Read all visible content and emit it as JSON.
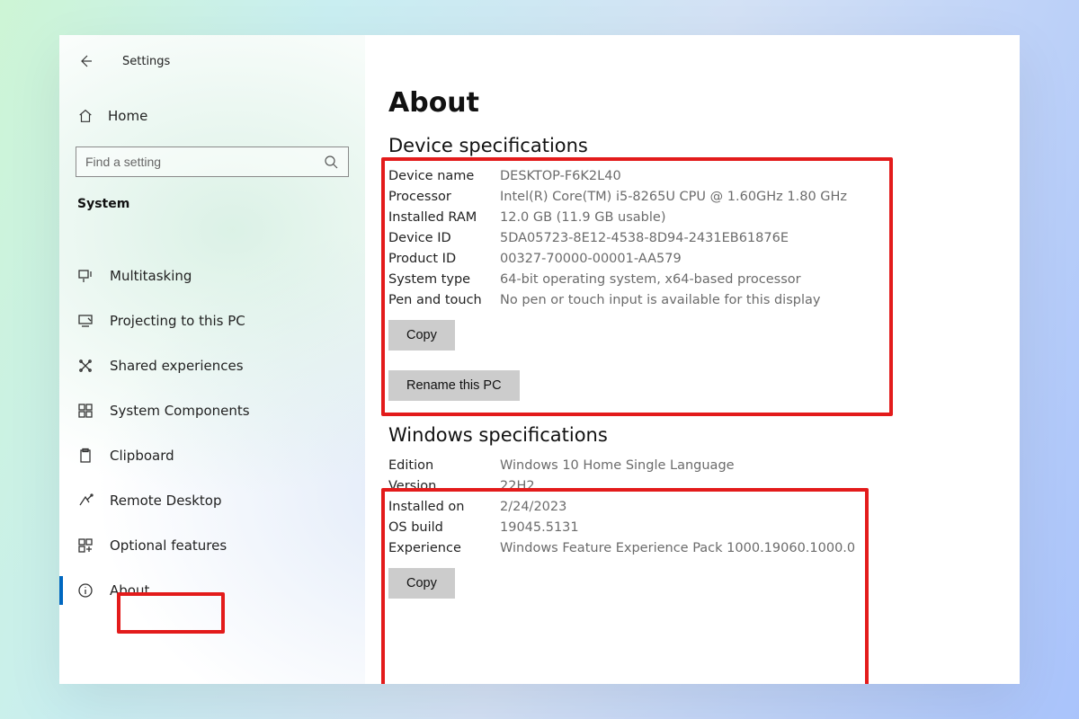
{
  "header": {
    "title": "Settings"
  },
  "sidebar": {
    "home_label": "Home",
    "search_placeholder": "Find a setting",
    "category": "System",
    "items": [
      {
        "icon": "multitask-icon",
        "label": "Multitasking"
      },
      {
        "icon": "project-icon",
        "label": "Projecting to this PC"
      },
      {
        "icon": "shared-icon",
        "label": "Shared experiences"
      },
      {
        "icon": "components-icon",
        "label": "System Components"
      },
      {
        "icon": "clipboard-icon",
        "label": "Clipboard"
      },
      {
        "icon": "remote-icon",
        "label": "Remote Desktop"
      },
      {
        "icon": "optional-icon",
        "label": "Optional features"
      },
      {
        "icon": "info-icon",
        "label": "About",
        "active": true
      }
    ]
  },
  "main": {
    "title": "About",
    "device": {
      "heading": "Device specifications",
      "rows": {
        "device_name": {
          "k": "Device name",
          "v": "DESKTOP-F6K2L40"
        },
        "processor": {
          "k": "Processor",
          "v": "Intel(R) Core(TM) i5-8265U CPU @ 1.60GHz   1.80 GHz"
        },
        "installed_ram": {
          "k": "Installed RAM",
          "v": "12.0 GB (11.9 GB usable)"
        },
        "device_id": {
          "k": "Device ID",
          "v": "5DA05723-8E12-4538-8D94-2431EB61876E"
        },
        "product_id": {
          "k": "Product ID",
          "v": "00327-70000-00001-AA579"
        },
        "system_type": {
          "k": "System type",
          "v": "64-bit operating system, x64-based processor"
        },
        "pen_touch": {
          "k": "Pen and touch",
          "v": "No pen or touch input is available for this display"
        }
      },
      "copy_label": "Copy"
    },
    "rename_label": "Rename this PC",
    "windows": {
      "heading": "Windows specifications",
      "rows": {
        "edition": {
          "k": "Edition",
          "v": "Windows 10 Home Single Language"
        },
        "version": {
          "k": "Version",
          "v": "22H2"
        },
        "installed_on": {
          "k": "Installed on",
          "v": "2/24/2023"
        },
        "os_build": {
          "k": "OS build",
          "v": "19045.5131"
        },
        "experience": {
          "k": "Experience",
          "v": "Windows Feature Experience Pack 1000.19060.1000.0"
        }
      },
      "copy_label": "Copy"
    }
  }
}
